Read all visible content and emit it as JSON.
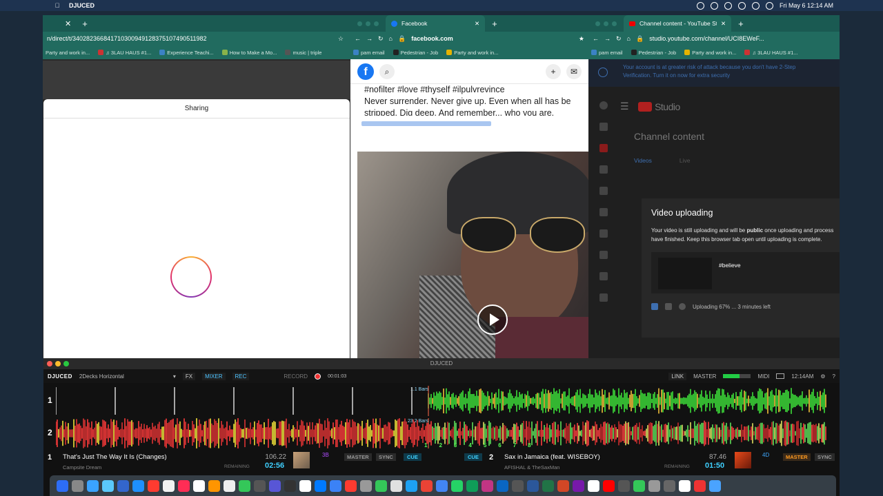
{
  "menubar": {
    "app_name": "DJUCED",
    "datetime": "Fri May 6  12:14 AM"
  },
  "window_left": {
    "url": "n/direct/t/340282366841710300949128375107490511982",
    "bookmarks": [
      "Party and work in...",
      "♫ 3LAU HAUS #1...",
      "Experience Teachi...",
      "How to Make a Mo...",
      "music | triple"
    ],
    "panel_title": "Sharing"
  },
  "window_facebook": {
    "tab_title": "Facebook",
    "url": "facebook.com",
    "bookmarks": [
      "pam email",
      "Pedestrian - Job",
      "Party and work in..."
    ],
    "post_lines": [
      "#nofilter #love #thyself #ilpulvrevince",
      "Never surrender. Never give up. Even when all has be",
      "stripped. Dig deep. And remember... who you are."
    ]
  },
  "window_youtube": {
    "tab_title": "Channel content - YouTube St",
    "url": "studio.youtube.com/channel/UCI8EWeF...",
    "bookmarks": [
      "pam email",
      "Pedestrian - Job",
      "Party and work in...",
      "♫ 3LAU HAUS #1..."
    ],
    "warning_line1": "Your account is at greater risk of attack because you don't have 2-Step",
    "warning_line2": "Verification. Turn it on now for extra security",
    "logo_text": "Studio",
    "page_title": "Channel content",
    "tabs": [
      "Videos",
      "Live"
    ],
    "modal": {
      "title": "Video uploading",
      "body_pre": "Your video is still uploading and will be ",
      "body_bold": "public",
      "body_post": " once uploading and process",
      "body_line2": "have finished. Keep this browser tab open until uploading is complete.",
      "video_title": "#believe",
      "status": "Uploading 67% ... 3 minutes left"
    }
  },
  "djuced": {
    "window_title": "DJUCED",
    "logo": "DJUCED",
    "layout": "2Decks Horizontal",
    "toolbar": {
      "fx": "FX",
      "mixer": "MIXER",
      "rec": "REC",
      "record": "RECORD",
      "record_time": "00:01:03",
      "link": "LINK",
      "master": "MASTER",
      "midi": "MIDI",
      "clock": "12:14AM"
    },
    "deck1": {
      "number": "1",
      "bars": "1.1 Bars",
      "title": "That's Just The Way It Is (Changes)",
      "artist": "Campsite Dream",
      "bpm": "106.22",
      "remaining_label": "REMAINING",
      "remaining": "02:56",
      "key": "3B",
      "master": "MASTER",
      "sync": "SYNC",
      "cue": "CUE"
    },
    "deck2": {
      "number": "2",
      "bars": "23.2 Bars",
      "title": "Sax in Jamaica (feat. WISEBOY)",
      "artist": "AFISHAL & TheSaxMan",
      "bpm": "87.46",
      "remaining_label": "REMAINING",
      "remaining": "01:50",
      "key": "4D",
      "master": "MASTER",
      "sync": "SYNC",
      "cue": "CUE"
    },
    "beat_markers": [
      "1",
      "2",
      "3",
      "4",
      "5",
      "6",
      "7",
      "8"
    ]
  }
}
